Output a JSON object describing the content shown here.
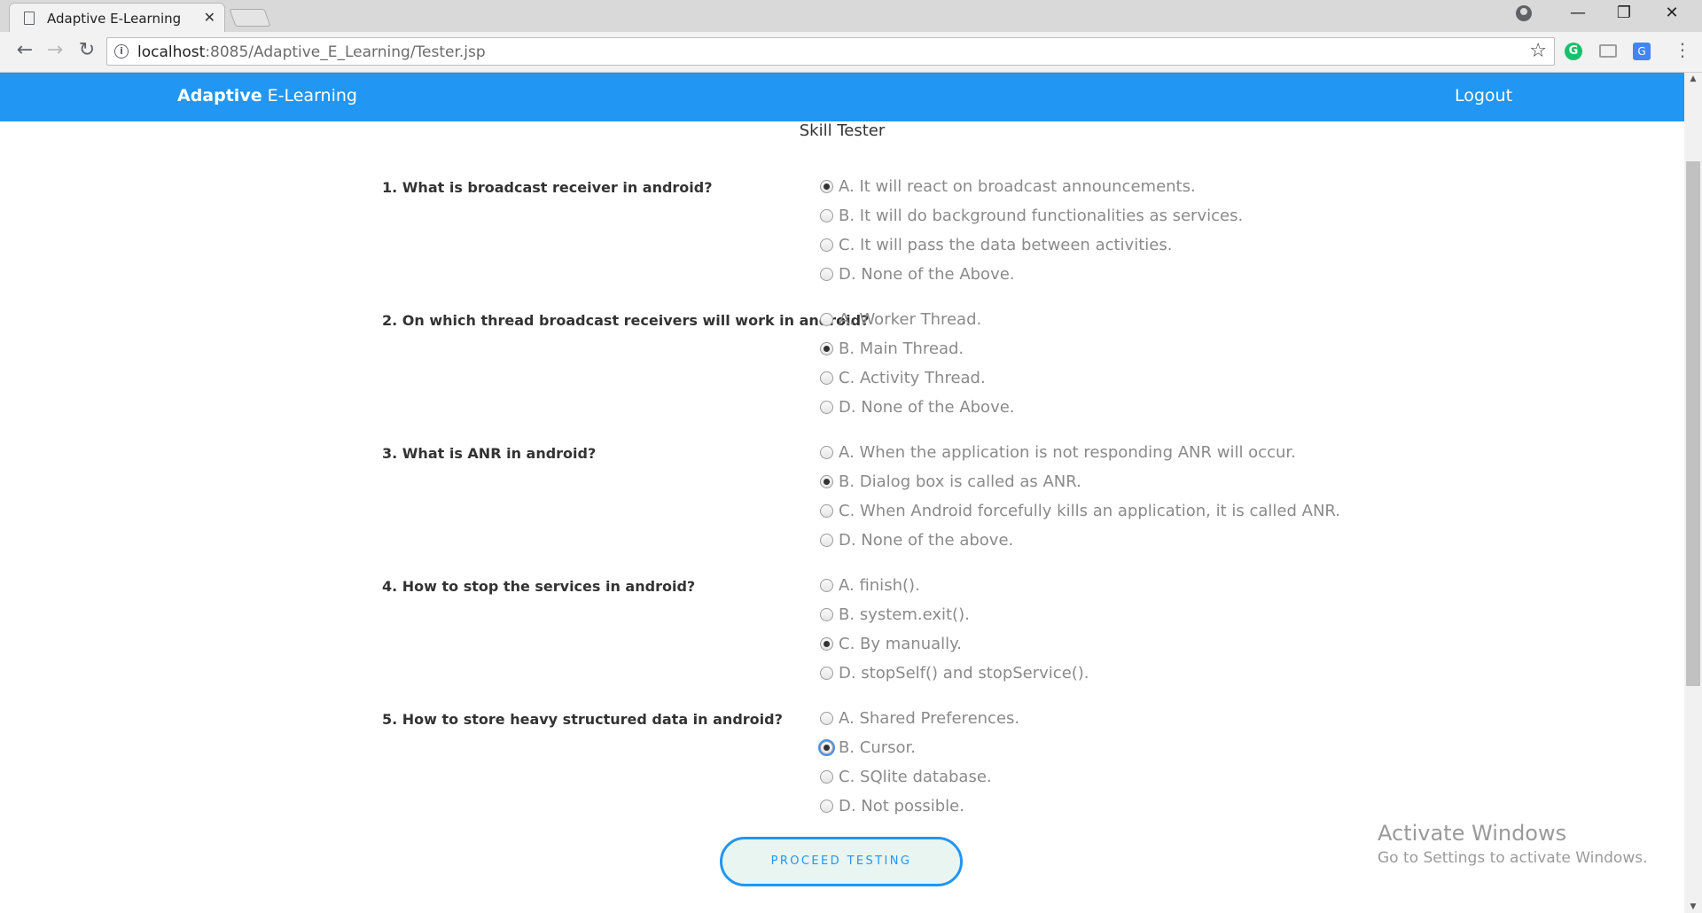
{
  "browser": {
    "tab_title": "Adaptive E-Learning",
    "tab_close": "✕",
    "url_host": "localhost",
    "url_path": ":8085/Adaptive_E_Learning/Tester.jsp",
    "window_controls": [
      "—",
      "❐",
      "✕"
    ],
    "extension_grammarly": "G",
    "extension_translate": "G"
  },
  "header": {
    "brand_bold": "Adaptive",
    "brand_rest": " E-Learning",
    "logout_label": "Logout",
    "color": "#2196f3"
  },
  "page_title": "Skill Tester",
  "questions": [
    {
      "text": "1. What is broadcast receiver in android?",
      "options": [
        "A. It will react on broadcast announcements.",
        "B. It will do background functionalities as services.",
        "C. It will pass the data between activities.",
        "D. None of the Above."
      ],
      "selected": 0
    },
    {
      "text": "2. On which thread broadcast receivers will work in android?",
      "options": [
        "A. Worker Thread.",
        "B. Main Thread.",
        "C. Activity Thread.",
        "D. None of the Above."
      ],
      "selected": 1
    },
    {
      "text": "3. What is ANR in android?",
      "options": [
        "A. When the application is not responding ANR will occur.",
        "B. Dialog box is called as ANR.",
        "C. When Android forcefully kills an application, it is called ANR.",
        "D. None of the above."
      ],
      "selected": 1
    },
    {
      "text": "4. How to stop the services in android?",
      "options": [
        "A. finish().",
        "B. system.exit().",
        "C. By manually.",
        "D. stopSelf() and stopService()."
      ],
      "selected": 2
    },
    {
      "text": "5. How to store heavy structured data in android?",
      "options": [
        "A. Shared Preferences.",
        "B. Cursor.",
        "C. SQlite database.",
        "D. Not possible."
      ],
      "selected": 1
    }
  ],
  "proceed_label": "PROCEED TESTING",
  "watermark": {
    "title": "Activate Windows",
    "subtitle": "Go to Settings to activate Windows."
  }
}
